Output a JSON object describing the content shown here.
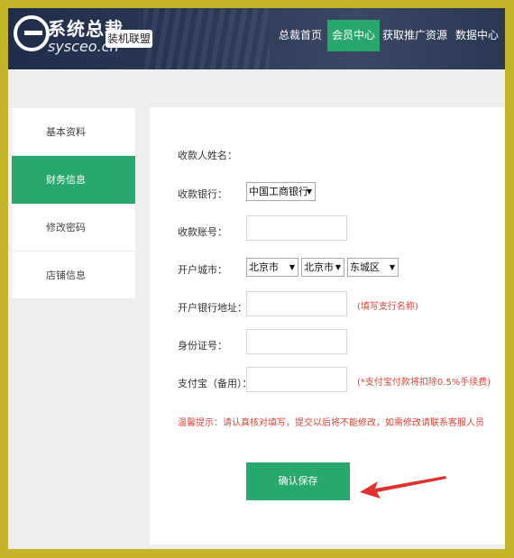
{
  "header": {
    "logo_title": "系统总裁",
    "logo_sub": "sysceo.cn",
    "alliance_badge": "装机联盟",
    "nav": [
      "总裁首页",
      "会员中心",
      "获取推广资源",
      "数据中心"
    ],
    "active_nav": "会员中心"
  },
  "sidebar": {
    "items": [
      "基本资料",
      "财务信息",
      "修改密码",
      "店铺信息"
    ],
    "active": "财务信息"
  },
  "form": {
    "payee_name_label": "收款人姓名：",
    "bank_label": "收款银行：",
    "bank_value": "中国工商银行",
    "account_label": "收款账号：",
    "account_value": "",
    "city_label": "开户城市：",
    "province_value": "北京市",
    "city_value": "北京市",
    "district_value": "东城区",
    "branch_label": "开户银行地址：",
    "branch_value": "",
    "branch_hint": "(填写支行名称)",
    "id_label": "身份证号：",
    "id_value": "",
    "alipay_label": "支付宝（备用）：",
    "alipay_value": "",
    "alipay_hint": "(*支付宝付款将扣除0.5%手续费)",
    "warning": "温馨提示：请认真核对填写，提交以后将不能修改，如需修改请联系客服人员",
    "save_label": "确认保存"
  },
  "colors": {
    "accent": "#27a86c",
    "frame": "#c5b32a",
    "header": "#2c3a58",
    "hint": "#d9463b",
    "arrow": "#e0312c"
  }
}
